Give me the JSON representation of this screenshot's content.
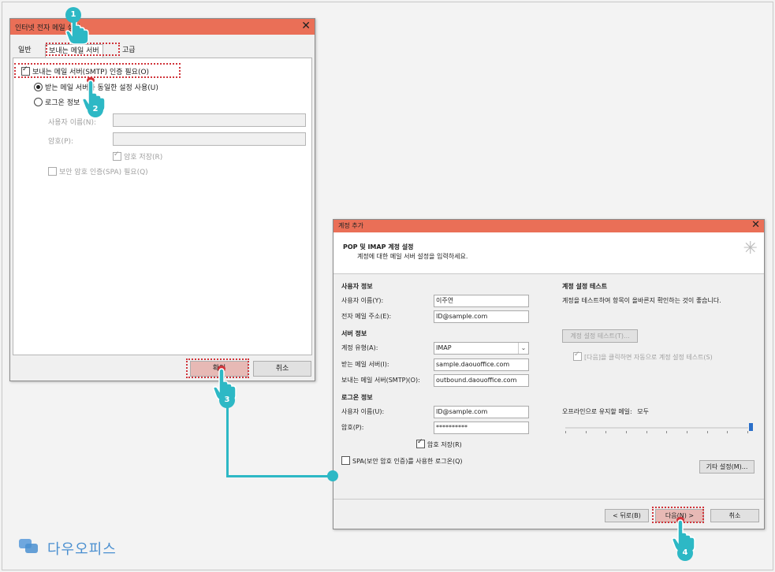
{
  "dialog1": {
    "title": "인터넷 전자 메일 설정",
    "tabs": [
      "일반",
      "보내는 메일 서버",
      "고급"
    ],
    "require_smtp_auth": "보내는 메일 서버(SMTP) 인증 필요(O)",
    "use_same_settings": "받는 메일 서버와 동일한 설정 사용(U)",
    "login_using": "로그온 정보",
    "username_label": "사용자 이름(N):",
    "password_label": "암호(P):",
    "remember_password": "암호 저장(R)",
    "spa": "보안 암호 인증(SPA) 필요(Q)",
    "ok": "확인",
    "cancel": "취소"
  },
  "dialog2": {
    "title": "계정 추가",
    "header_title": "POP 및 IMAP 계정 설정",
    "header_sub": "계정에 대한 메일 서버 설정을 입력하세요.",
    "user_info": "사용자 정보",
    "name_label": "사용자 이름(Y):",
    "name_value": "이주연",
    "email_label": "전자 메일 주소(E):",
    "email_value": "ID@sample.com",
    "server_info": "서버 정보",
    "account_type_label": "계정 유형(A):",
    "account_type_value": "IMAP",
    "incoming_label": "받는 메일 서버(I):",
    "incoming_value": "sample.daouoffice.com",
    "outgoing_label": "보내는 메일 서버(SMTP)(O):",
    "outgoing_value": "outbound.daouoffice.com",
    "logon_info": "로그온 정보",
    "user_label": "사용자 이름(U):",
    "user_value": "ID@sample.com",
    "pw_label": "암호(P):",
    "pw_value": "**********",
    "remember_pw": "암호 저장(R)",
    "spa": "SPA(보안 암호 인증)를 사용한 로그온(Q)",
    "test_title": "계정 설정 테스트",
    "test_desc": "계정을 테스트하여 항목이 올바른지 확인하는 것이 좋습니다.",
    "test_button": "계정 설정 테스트(T)...",
    "auto_test": "[다음]을 클릭하면 자동으로 계정 설정 테스트(S)",
    "offline_label": "오프라인으로 유지할 메일:",
    "offline_value": "모두",
    "more_settings": "기타 설정(M)...",
    "back": "< 뒤로(B)",
    "next": "다음(N) >",
    "cancel": "취소"
  },
  "steps": [
    "1",
    "2",
    "3",
    "4"
  ],
  "brand": "다우오피스",
  "colors": {
    "titlebar": "#ea6f57",
    "callout": "#2db8c5",
    "highlight": "#d0343a"
  }
}
